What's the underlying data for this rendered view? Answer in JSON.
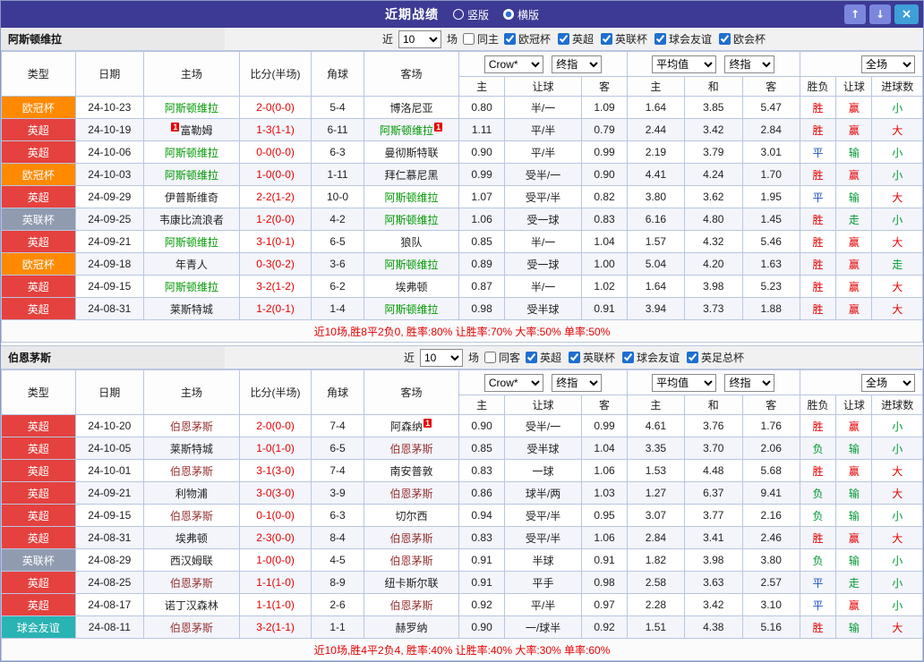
{
  "titlebar": {
    "title": "近期战绩",
    "vertical": "竖版",
    "horizontal": "横版",
    "up": "↑",
    "down": "↓",
    "close": "×"
  },
  "ui": {
    "near": "近",
    "games": "场"
  },
  "columns": {
    "type": "类型",
    "date": "日期",
    "home": "主场",
    "score": "比分(半场)",
    "corner": "角球",
    "away": "客场",
    "h": "主",
    "handicap": "让球",
    "a": "客",
    "eh": "主",
    "draw": "和",
    "ea": "客",
    "result": "胜负",
    "goals": "进球数"
  },
  "type_colors": {
    "欧冠杯": "#ff8a00",
    "英超": "#e5413e",
    "英联杯": "#909bb0",
    "球会友谊": "#2ab3b3",
    "英足总杯": "#b08ad0"
  },
  "outcome_colors": {
    "胜": "red",
    "平": "blue",
    "负": "green",
    "赢": "red",
    "走": "green",
    "输": "green",
    "大": "red",
    "小": "green"
  },
  "status_colors": {
    "red": "#e60000",
    "green": "#009933",
    "blue": "#1d52c8"
  },
  "sections": [
    {
      "team": "阿斯顿维拉",
      "focus_color": "#009900",
      "filter": {
        "count": "10",
        "same": "同主",
        "leagues": [
          "欧冠杯",
          "英超",
          "英联杯",
          "球会友谊",
          "欧会杯"
        ]
      },
      "selects": {
        "bookmaker": "Crow*",
        "final": "终指",
        "average": "平均值",
        "final2": "终指",
        "scope": "全场"
      },
      "rows": [
        {
          "type": "欧冠杯",
          "date": "24-10-23",
          "home": "阿斯顿维拉",
          "focus": "home",
          "score": "2-0(0-0)",
          "corners": "5-4",
          "away": "博洛尼亚",
          "ah": [
            "0.80",
            "半/一",
            "1.09"
          ],
          "eu": [
            "1.64",
            "3.85",
            "5.47"
          ],
          "res": [
            "胜",
            "赢",
            "小"
          ]
        },
        {
          "type": "英超",
          "date": "24-10-19",
          "home": "富勒姆",
          "home_badge": "1",
          "focus": "away",
          "score": "1-3(1-1)",
          "corners": "6-11",
          "away": "阿斯顿维拉",
          "away_badge": "1",
          "ah": [
            "1.11",
            "平/半",
            "0.79"
          ],
          "eu": [
            "2.44",
            "3.42",
            "2.84"
          ],
          "res": [
            "胜",
            "赢",
            "大"
          ]
        },
        {
          "type": "英超",
          "date": "24-10-06",
          "home": "阿斯顿维拉",
          "focus": "home",
          "score": "0-0(0-0)",
          "corners": "6-3",
          "away": "曼彻斯特联",
          "ah": [
            "0.90",
            "平/半",
            "0.99"
          ],
          "eu": [
            "2.19",
            "3.79",
            "3.01"
          ],
          "res": [
            "平",
            "输",
            "小"
          ]
        },
        {
          "type": "欧冠杯",
          "date": "24-10-03",
          "home": "阿斯顿维拉",
          "focus": "home",
          "score": "1-0(0-0)",
          "corners": "1-11",
          "away": "拜仁慕尼黑",
          "ah": [
            "0.99",
            "受半/一",
            "0.90"
          ],
          "eu": [
            "4.41",
            "4.24",
            "1.70"
          ],
          "res": [
            "胜",
            "赢",
            "小"
          ]
        },
        {
          "type": "英超",
          "date": "24-09-29",
          "home": "伊普斯维奇",
          "focus": "away",
          "score": "2-2(1-2)",
          "corners": "10-0",
          "away": "阿斯顿维拉",
          "ah": [
            "1.07",
            "受平/半",
            "0.82"
          ],
          "eu": [
            "3.80",
            "3.62",
            "1.95"
          ],
          "res": [
            "平",
            "输",
            "大"
          ]
        },
        {
          "type": "英联杯",
          "date": "24-09-25",
          "home": "韦康比流浪者",
          "focus": "away",
          "score": "1-2(0-0)",
          "corners": "4-2",
          "away": "阿斯顿维拉",
          "ah": [
            "1.06",
            "受一球",
            "0.83"
          ],
          "eu": [
            "6.16",
            "4.80",
            "1.45"
          ],
          "res": [
            "胜",
            "走",
            "小"
          ]
        },
        {
          "type": "英超",
          "date": "24-09-21",
          "home": "阿斯顿维拉",
          "focus": "home",
          "score": "3-1(0-1)",
          "corners": "6-5",
          "away": "狼队",
          "ah": [
            "0.85",
            "半/一",
            "1.04"
          ],
          "eu": [
            "1.57",
            "4.32",
            "5.46"
          ],
          "res": [
            "胜",
            "赢",
            "大"
          ]
        },
        {
          "type": "欧冠杯",
          "date": "24-09-18",
          "home": "年青人",
          "focus": "away",
          "score": "0-3(0-2)",
          "corners": "3-6",
          "away": "阿斯顿维拉",
          "ah": [
            "0.89",
            "受一球",
            "1.00"
          ],
          "eu": [
            "5.04",
            "4.20",
            "1.63"
          ],
          "res": [
            "胜",
            "赢",
            "走"
          ]
        },
        {
          "type": "英超",
          "date": "24-09-15",
          "home": "阿斯顿维拉",
          "focus": "home",
          "score": "3-2(1-2)",
          "corners": "6-2",
          "away": "埃弗顿",
          "ah": [
            "0.87",
            "半/一",
            "1.02"
          ],
          "eu": [
            "1.64",
            "3.98",
            "5.23"
          ],
          "res": [
            "胜",
            "赢",
            "大"
          ]
        },
        {
          "type": "英超",
          "date": "24-08-31",
          "home": "莱斯特城",
          "focus": "away",
          "score": "1-2(0-1)",
          "corners": "1-4",
          "away": "阿斯顿维拉",
          "ah": [
            "0.98",
            "受半球",
            "0.91"
          ],
          "eu": [
            "3.94",
            "3.73",
            "1.88"
          ],
          "res": [
            "胜",
            "赢",
            "大"
          ]
        }
      ],
      "footer": "近10场,胜8平2负0, 胜率:80% 让胜率:70% 大率:50% 单率:50%"
    },
    {
      "team": "伯恩茅斯",
      "focus_color": "#993333",
      "filter": {
        "count": "10",
        "same": "同客",
        "leagues": [
          "英超",
          "英联杯",
          "球会友谊",
          "英足总杯"
        ]
      },
      "selects": {
        "bookmaker": "Crow*",
        "final": "终指",
        "average": "平均值",
        "final2": "终指",
        "scope": "全场"
      },
      "rows": [
        {
          "type": "英超",
          "date": "24-10-20",
          "home": "伯恩茅斯",
          "focus": "home",
          "score": "2-0(0-0)",
          "corners": "7-4",
          "away": "阿森纳",
          "away_badge": "1",
          "ah": [
            "0.90",
            "受半/一",
            "0.99"
          ],
          "eu": [
            "4.61",
            "3.76",
            "1.76"
          ],
          "res": [
            "胜",
            "赢",
            "小"
          ]
        },
        {
          "type": "英超",
          "date": "24-10-05",
          "home": "莱斯特城",
          "focus": "away",
          "score": "1-0(1-0)",
          "corners": "6-5",
          "away": "伯恩茅斯",
          "ah": [
            "0.85",
            "受半球",
            "1.04"
          ],
          "eu": [
            "3.35",
            "3.70",
            "2.06"
          ],
          "res": [
            "负",
            "输",
            "小"
          ]
        },
        {
          "type": "英超",
          "date": "24-10-01",
          "home": "伯恩茅斯",
          "focus": "home",
          "score": "3-1(3-0)",
          "corners": "7-4",
          "away": "南安普敦",
          "ah": [
            "0.83",
            "一球",
            "1.06"
          ],
          "eu": [
            "1.53",
            "4.48",
            "5.68"
          ],
          "res": [
            "胜",
            "赢",
            "大"
          ]
        },
        {
          "type": "英超",
          "date": "24-09-21",
          "home": "利物浦",
          "focus": "away",
          "score": "3-0(3-0)",
          "corners": "3-9",
          "away": "伯恩茅斯",
          "ah": [
            "0.86",
            "球半/两",
            "1.03"
          ],
          "eu": [
            "1.27",
            "6.37",
            "9.41"
          ],
          "res": [
            "负",
            "输",
            "大"
          ]
        },
        {
          "type": "英超",
          "date": "24-09-15",
          "home": "伯恩茅斯",
          "focus": "home",
          "score": "0-1(0-0)",
          "corners": "6-3",
          "away": "切尔西",
          "ah": [
            "0.94",
            "受平/半",
            "0.95"
          ],
          "eu": [
            "3.07",
            "3.77",
            "2.16"
          ],
          "res": [
            "负",
            "输",
            "小"
          ]
        },
        {
          "type": "英超",
          "date": "24-08-31",
          "home": "埃弗顿",
          "focus": "away",
          "score": "2-3(0-0)",
          "corners": "8-4",
          "away": "伯恩茅斯",
          "ah": [
            "0.83",
            "受平/半",
            "1.06"
          ],
          "eu": [
            "2.84",
            "3.41",
            "2.46"
          ],
          "res": [
            "胜",
            "赢",
            "大"
          ]
        },
        {
          "type": "英联杯",
          "date": "24-08-29",
          "home": "西汉姆联",
          "focus": "away",
          "score": "1-0(0-0)",
          "corners": "4-5",
          "away": "伯恩茅斯",
          "ah": [
            "0.91",
            "半球",
            "0.91"
          ],
          "eu": [
            "1.82",
            "3.98",
            "3.80"
          ],
          "res": [
            "负",
            "输",
            "小"
          ]
        },
        {
          "type": "英超",
          "date": "24-08-25",
          "home": "伯恩茅斯",
          "focus": "home",
          "score": "1-1(1-0)",
          "corners": "8-9",
          "away": "纽卡斯尔联",
          "ah": [
            "0.91",
            "平手",
            "0.98"
          ],
          "eu": [
            "2.58",
            "3.63",
            "2.57"
          ],
          "res": [
            "平",
            "走",
            "小"
          ]
        },
        {
          "type": "英超",
          "date": "24-08-17",
          "home": "诺丁汉森林",
          "focus": "away",
          "score": "1-1(1-0)",
          "corners": "2-6",
          "away": "伯恩茅斯",
          "ah": [
            "0.92",
            "平/半",
            "0.97"
          ],
          "eu": [
            "2.28",
            "3.42",
            "3.10"
          ],
          "res": [
            "平",
            "赢",
            "小"
          ]
        },
        {
          "type": "球会友谊",
          "date": "24-08-11",
          "home": "伯恩茅斯",
          "focus": "home",
          "score": "3-2(1-1)",
          "corners": "1-1",
          "away": "赫罗纳",
          "ah": [
            "0.90",
            "一/球半",
            "0.92"
          ],
          "eu": [
            "1.51",
            "4.38",
            "5.16"
          ],
          "res": [
            "胜",
            "输",
            "大"
          ]
        }
      ],
      "footer": "近10场,胜4平2负4, 胜率:40% 让胜率:40% 大率:30% 单率:60%"
    }
  ]
}
